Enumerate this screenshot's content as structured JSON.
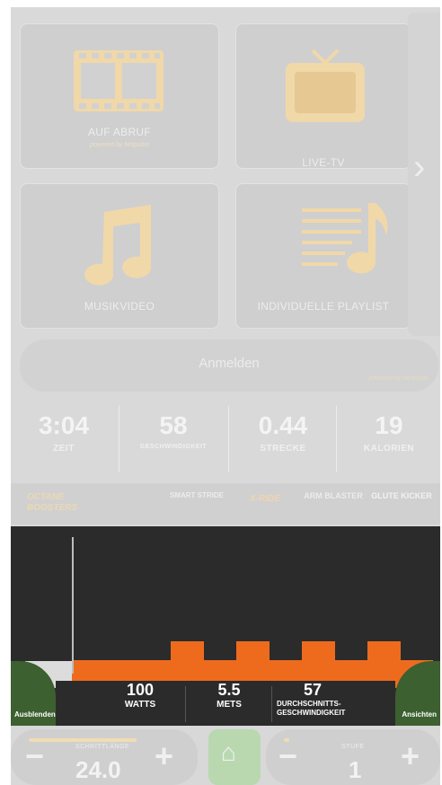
{
  "tiles": [
    {
      "label": "AUF ABRUF",
      "sub": "powered by Netpulse",
      "icon": "film-strip-icon"
    },
    {
      "label": "LIVE-TV",
      "icon": "tv-icon"
    },
    {
      "label": "MUSIKVIDEO",
      "icon": "music-note-icon"
    },
    {
      "label": "INDIVIDUELLE PLAYLIST",
      "icon": "playlist-icon"
    }
  ],
  "nav_next_icon": "chevron-right-icon",
  "signin": {
    "label": "Anmelden",
    "sub": "powered by Netpulse"
  },
  "stats": [
    {
      "value": "3:04",
      "label": "ZEIT"
    },
    {
      "value": "58",
      "label": "GESCHWINDIGKEIT"
    },
    {
      "value": "0.44",
      "label": "STRECKE"
    },
    {
      "value": "19",
      "label": "KALORIEN"
    }
  ],
  "boosters": {
    "title_line1": "OCTANE",
    "title_line2": "BOOSTERS",
    "buttons": [
      "SMART STRIDE",
      "X-RIDE",
      "ARM BLASTER",
      "GLUTE KICKER"
    ]
  },
  "panel": {
    "left_label": "Ausblenden",
    "right_label": "Ansichten",
    "metrics": [
      {
        "value": "100",
        "label": "WATTS"
      },
      {
        "value": "5.5",
        "label": "METS"
      },
      {
        "value": "57",
        "label": "DURCHSCHNITTS-GESCHWINDIGKEIT"
      }
    ],
    "profile": {
      "completed_fraction": 0.13,
      "levels": [
        1,
        1,
        1,
        2,
        1,
        2,
        1,
        2,
        1,
        2,
        1
      ]
    }
  },
  "controls": {
    "left": {
      "caption": "SCHRITTLÄNGE",
      "value": "24.0",
      "minus": "−",
      "plus": "+"
    },
    "home_icon": "home-icon",
    "right": {
      "caption": "STUFE",
      "value": "1",
      "minus": "−",
      "plus": "+"
    }
  },
  "colors": {
    "accent": "#ee6b1e",
    "panel": "#2b2b2b",
    "green": "#3c6030"
  }
}
